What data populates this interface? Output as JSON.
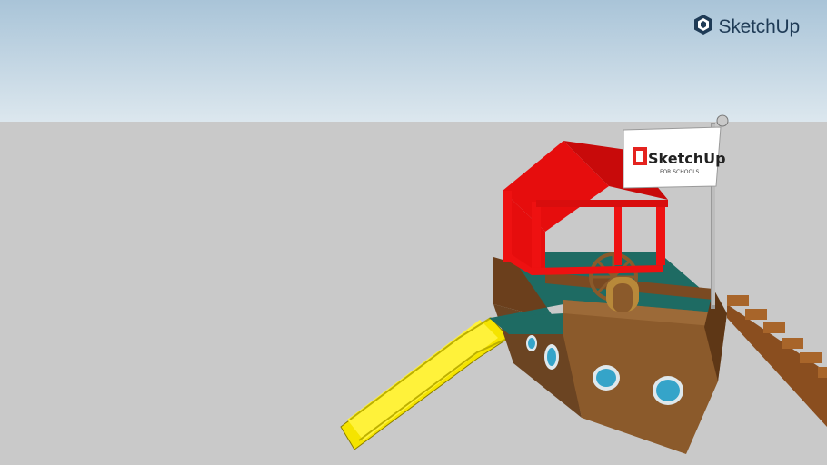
{
  "app": {
    "brand_name": "SketchUp",
    "icon": "sketchup-logo-icon"
  },
  "scene": {
    "flag": {
      "title": "SketchUp",
      "subtitle": "FOR SCHOOLS",
      "icon": "sketchup-logo-icon"
    }
  },
  "colors": {
    "sky_top": "#a9c4d8",
    "sky_bottom": "#dce7ee",
    "ground": "#c9c9c9",
    "roof": "#e60d0d",
    "hull": "#7a4a22",
    "deck": "#1e6b63",
    "slide": "#ffee00",
    "brand": "#1f3b56"
  }
}
